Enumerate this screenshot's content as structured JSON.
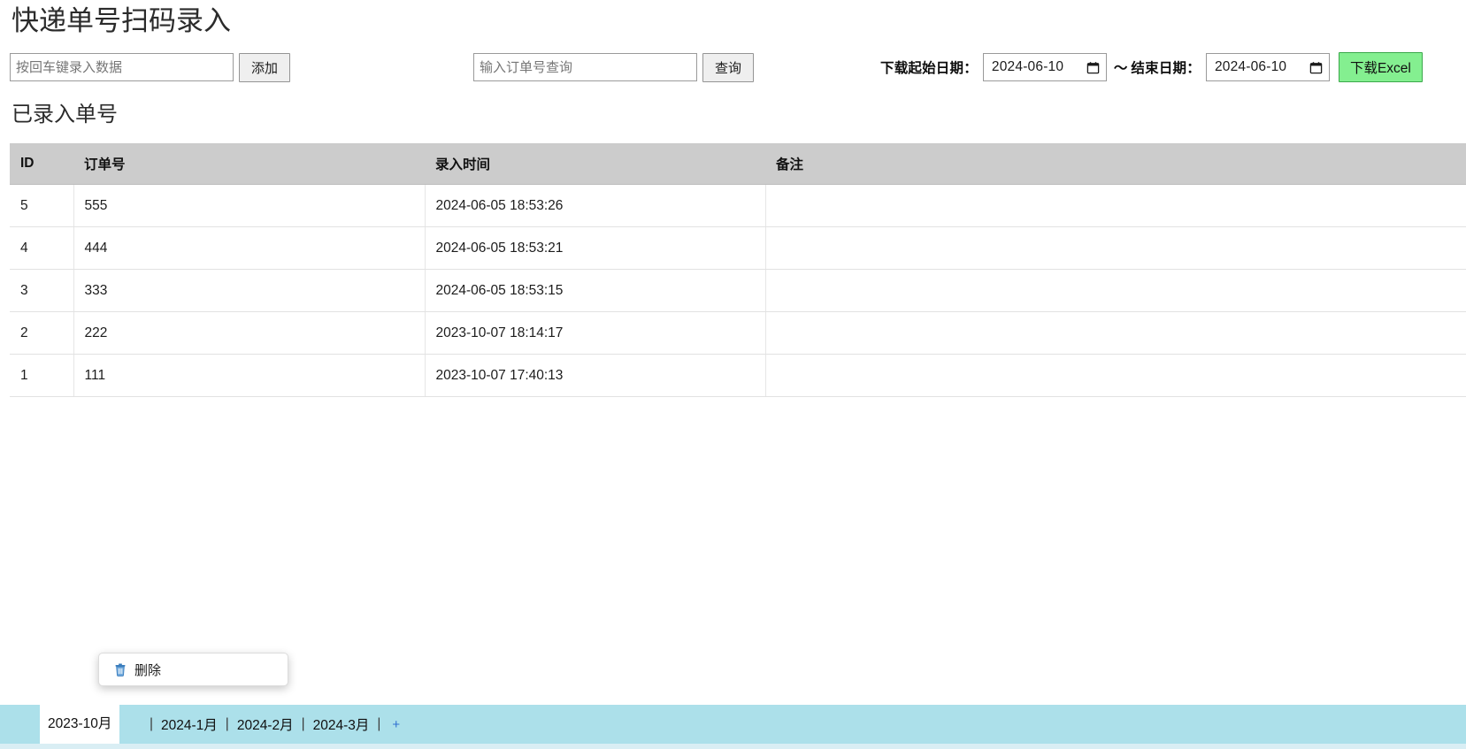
{
  "page": {
    "title": "快递单号扫码录入",
    "section_heading": "已录入单号"
  },
  "toolbar": {
    "entry_input_placeholder": "按回车键录入数据",
    "entry_input_value": "",
    "add_button": "添加",
    "query_input_placeholder": "输入订单号查询",
    "query_input_value": "",
    "query_button": "查询",
    "start_date_label": "下载起始日期：",
    "start_date_value": "2024-06-10",
    "range_separator": "～",
    "end_date_label": "结束日期：",
    "end_date_value": "2024-06-10",
    "download_button": "下载Excel",
    "download_button_color": "#84ef90"
  },
  "table": {
    "columns": [
      "ID",
      "订单号",
      "录入时间",
      "备注"
    ],
    "header_background": "#cccccc",
    "rows": [
      {
        "id": "5",
        "order_no": "555",
        "time": "2024-06-05 18:53:26",
        "remark": ""
      },
      {
        "id": "4",
        "order_no": "444",
        "time": "2024-06-05 18:53:21",
        "remark": ""
      },
      {
        "id": "3",
        "order_no": "333",
        "time": "2024-06-05 18:53:15",
        "remark": ""
      },
      {
        "id": "2",
        "order_no": "222",
        "time": "2023-10-07 18:14:17",
        "remark": ""
      },
      {
        "id": "1",
        "order_no": "111",
        "time": "2023-10-07 17:40:13",
        "remark": ""
      }
    ]
  },
  "tabbar": {
    "background": "#ace0ea",
    "active_tab": "2023-10月",
    "tabs": [
      "2024-1月",
      "2024-2月",
      "2024-3月"
    ],
    "separator": "|",
    "add_tab": "+"
  },
  "context_menu": {
    "items": [
      {
        "icon": "trash-icon",
        "label": "删除"
      }
    ]
  }
}
